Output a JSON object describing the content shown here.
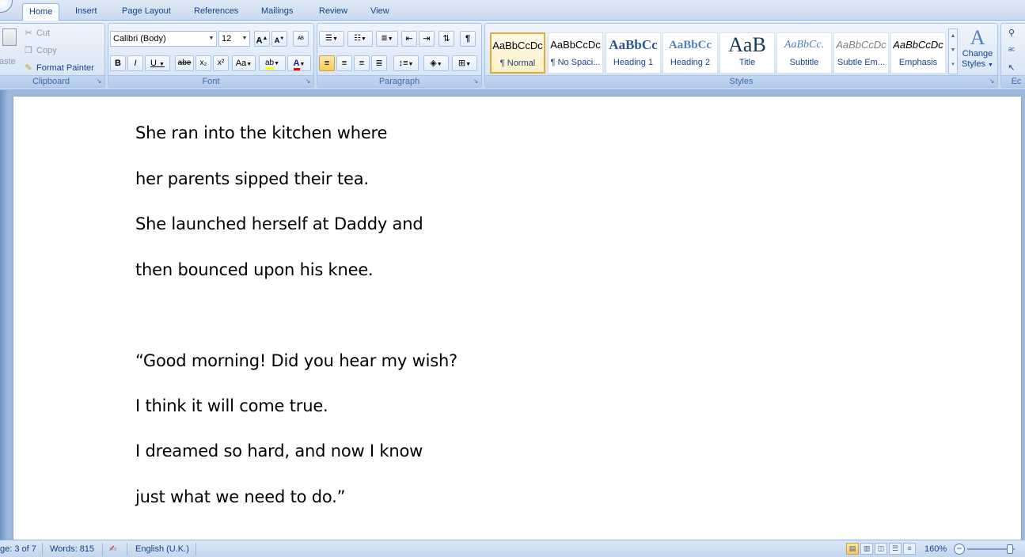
{
  "tabs": [
    "Home",
    "Insert",
    "Page Layout",
    "References",
    "Mailings",
    "Review",
    "View"
  ],
  "clipboard": {
    "paste_label": "aste",
    "cut_label": "Cut",
    "copy_label": "Copy",
    "format_painter_label": "Format Painter",
    "group_label": "Clipboard"
  },
  "font": {
    "font_name": "Calibri (Body)",
    "font_size": "12",
    "group_label": "Font",
    "grow_icon": "A",
    "shrink_icon": "A",
    "clear_icon": "ᴬᴮ",
    "bold_icon": "B",
    "italic_icon": "I",
    "underline_icon": "U",
    "strike_icon": "abe",
    "subscript_icon": "x₂",
    "superscript_icon": "x²",
    "case_icon": "Aa",
    "highlight_icon": "ab",
    "font_color_icon": "A"
  },
  "paragraph": {
    "group_label": "Paragraph"
  },
  "styles": {
    "group_label": "Styles",
    "items": [
      {
        "sample": "AaBbCcDc",
        "name": "¶ Normal"
      },
      {
        "sample": "AaBbCcDc",
        "name": "¶ No Spaci..."
      },
      {
        "sample": "AaBbCc",
        "name": "Heading 1"
      },
      {
        "sample": "AaBbCc",
        "name": "Heading 2"
      },
      {
        "sample": "AaB",
        "name": "Title"
      },
      {
        "sample": "AaBbCc.",
        "name": "Subtitle"
      },
      {
        "sample": "AaBbCcDc",
        "name": "Subtle Em..."
      },
      {
        "sample": "AaBbCcDc",
        "name": "Emphasis"
      }
    ],
    "change_styles_label_1": "Change",
    "change_styles_label_2": "Styles"
  },
  "editing": {
    "group_label_partial": "Ec"
  },
  "document": {
    "lines": [
      "She ran into the kitchen where",
      "her parents sipped their tea.",
      "She launched herself at Daddy and",
      "then bounced upon his knee.",
      "“Good morning! Did you hear my wish?",
      "I think it will come true.",
      "I dreamed so hard, and now I know",
      "just what we need to do.”"
    ]
  },
  "status": {
    "page": "ge: 3 of 7",
    "words": "Words: 815",
    "language": "English (U.K.)",
    "zoom": "160%"
  },
  "colors": {
    "ribbon_bg": "#dbe7f6",
    "accent": "#15428b",
    "selected_style_border": "#e5a93a",
    "font_color_bar": "#ff0000"
  }
}
